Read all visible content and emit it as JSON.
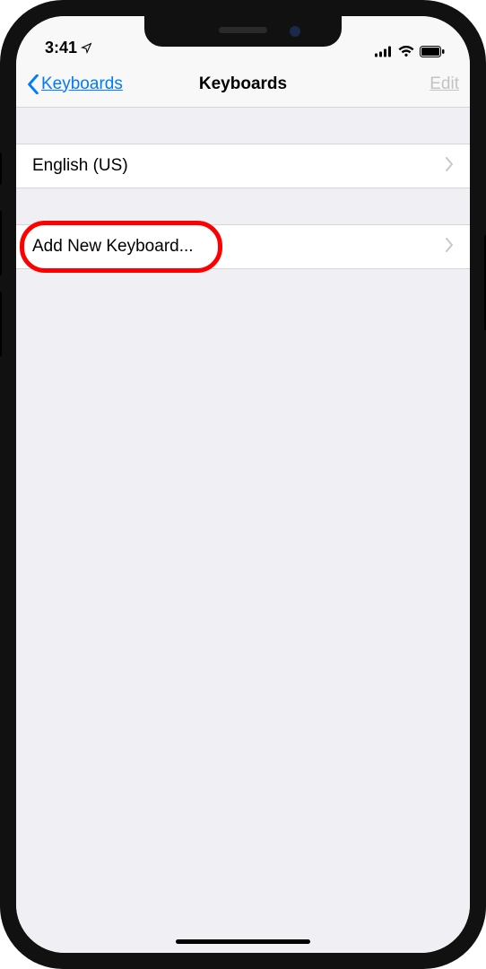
{
  "status": {
    "time": "3:41"
  },
  "nav": {
    "back_label": "Keyboards",
    "title": "Keyboards",
    "edit_label": "Edit"
  },
  "rows": {
    "keyboard_0": "English (US)",
    "add_new": "Add New Keyboard..."
  }
}
